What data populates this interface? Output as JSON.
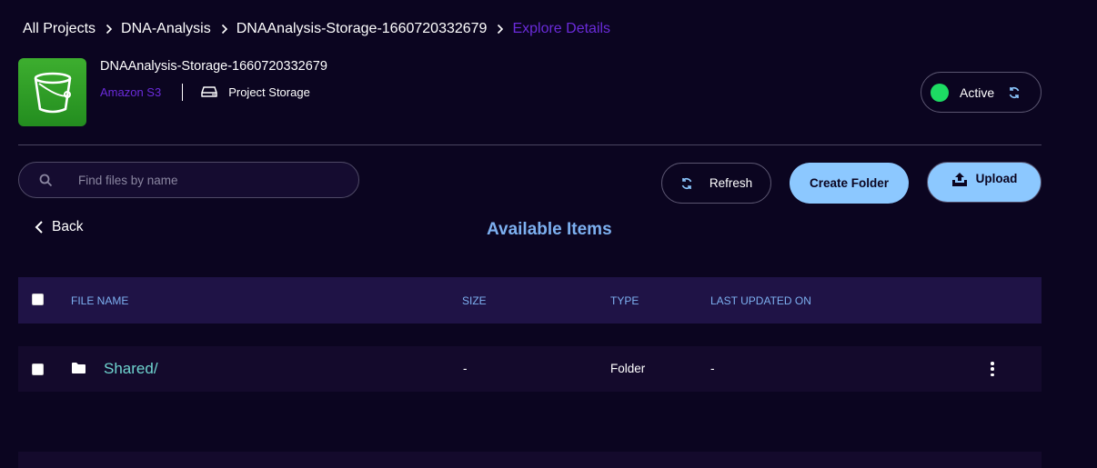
{
  "breadcrumb": {
    "items": [
      "All Projects",
      "DNA-Analysis",
      "DNAAnalysis-Storage-1660720332679"
    ],
    "current": "Explore Details"
  },
  "storage": {
    "name": "DNAAnalysis-Storage-1660720332679",
    "provider": "Amazon S3",
    "type": "Project Storage"
  },
  "status": {
    "label": "Active",
    "color": "#1ddb63"
  },
  "search": {
    "placeholder": "Find files by name",
    "value": ""
  },
  "actions": {
    "refresh_label": "Refresh",
    "create_folder_label": "Create Folder",
    "upload_label": "Upload"
  },
  "nav": {
    "back_label": "Back"
  },
  "section": {
    "title": "Available Items"
  },
  "table": {
    "columns": [
      "FILE NAME",
      "SIZE",
      "TYPE",
      "LAST UPDATED ON"
    ],
    "rows": [
      {
        "name": "Shared/",
        "size": "-",
        "type": "Folder",
        "updated": "-",
        "icon": "folder-icon"
      }
    ]
  },
  "colors": {
    "background": "#0b0520",
    "accent_purple": "#6a2bd9",
    "accent_blue": "#8cc8ff",
    "header_text": "#7db0f0",
    "file_link": "#6fd4cf",
    "table_header_bg": "#1f1346"
  }
}
